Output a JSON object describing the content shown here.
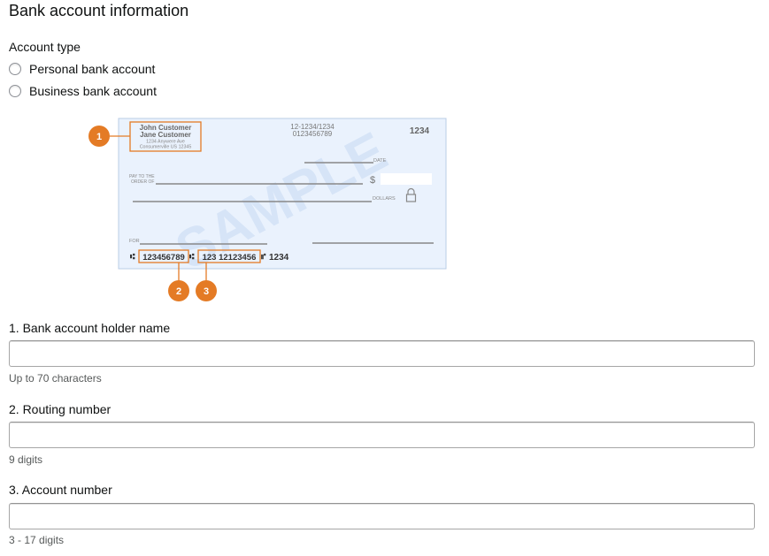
{
  "page": {
    "title": "Bank account information"
  },
  "account_type": {
    "label": "Account type",
    "options": [
      "Personal bank account",
      "Business bank account"
    ]
  },
  "sample_check": {
    "watermark": "SAMPLE",
    "holder_names": [
      "John Customer",
      "Jane Customer"
    ],
    "address_lines": [
      "1234 Anywere Ave",
      "Consumerville US 12345"
    ],
    "fraction_code": [
      "12-1234/1234",
      "0123456789"
    ],
    "check_number": "1234",
    "date_label": "DATE",
    "pay_to_label": [
      "PAY TO THE",
      "ORDER OF"
    ],
    "dollar_sign": "$",
    "dollars_label": "DOLLARS",
    "for_label": "FOR",
    "routing_digits": "123456789",
    "account_digits": "123 12123456",
    "micr_check_number": "1234",
    "callouts": [
      "1",
      "2",
      "3"
    ],
    "accent_color": "#e47b25",
    "background_color": "#eaf2fd"
  },
  "fields": [
    {
      "label": "1. Bank account holder name",
      "value": "",
      "hint": "Up to 70 characters"
    },
    {
      "label": "2. Routing number",
      "value": "",
      "hint": "9 digits"
    },
    {
      "label": "3. Account number",
      "value": "",
      "hint": "3 - 17 digits"
    }
  ]
}
